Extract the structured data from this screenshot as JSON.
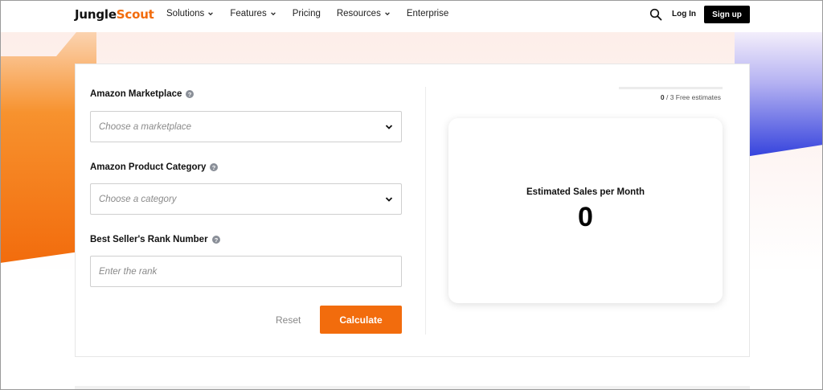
{
  "nav": {
    "logo_part1": "Jungle",
    "logo_part2": "Scout",
    "links": [
      "Solutions",
      "Features",
      "Pricing",
      "Resources",
      "Enterprise"
    ],
    "login": "Log In",
    "signup": "Sign up"
  },
  "form": {
    "marketplace_label": "Amazon Marketplace",
    "marketplace_placeholder": "Choose a marketplace",
    "category_label": "Amazon Product Category",
    "category_placeholder": "Choose a category",
    "rank_label": "Best Seller's Rank Number",
    "rank_placeholder": "Enter the rank",
    "reset": "Reset",
    "calculate": "Calculate"
  },
  "estimates": {
    "used": "0",
    "limit": "/ 3 Free estimates",
    "progress_fraction": 0
  },
  "result": {
    "title": "Estimated Sales per Month",
    "value": "0"
  },
  "colors": {
    "accent": "#f26c0d",
    "secondary": "#3b46e0"
  },
  "icons": [
    "search-icon",
    "chevron-down-icon",
    "help-icon"
  ]
}
